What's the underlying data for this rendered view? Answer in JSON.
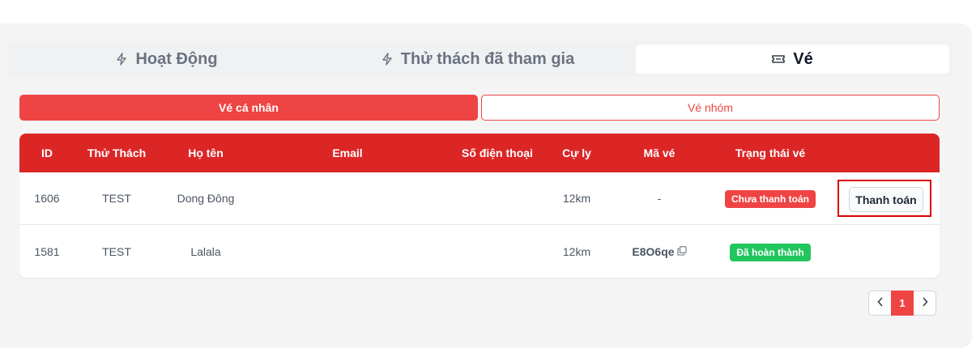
{
  "tabs": [
    {
      "label": "Hoạt Động",
      "icon": "bolt-icon"
    },
    {
      "label": "Thử thách đã tham gia",
      "icon": "bolt-icon"
    },
    {
      "label": "Vé",
      "icon": "ticket-icon",
      "active": true
    }
  ],
  "subtabs": {
    "personal": "Vé cá nhân",
    "group": "Vé nhóm"
  },
  "table": {
    "headers": [
      "ID",
      "Thử Thách",
      "Họ tên",
      "Email",
      "Số điện thoại",
      "Cự ly",
      "Mã vé",
      "Trạng thái vé"
    ],
    "rows": [
      {
        "id": "1606",
        "challenge": "TEST",
        "name": "Dong Đông",
        "email": "",
        "phone": "",
        "distance": "12km",
        "code": "-",
        "status": "Chưa thanh toán",
        "action": "Thanh toán"
      },
      {
        "id": "1581",
        "challenge": "TEST",
        "name": "Lalala",
        "email": "",
        "phone": "",
        "distance": "12km",
        "code": "E8O6qe",
        "status": "Đã hoàn thành"
      }
    ]
  },
  "pagination": {
    "current": "1",
    "prev_icon": "chevron-left-icon",
    "next_icon": "chevron-right-icon"
  },
  "colors": {
    "accent": "#ef4444",
    "header": "#dc2626",
    "success": "#22c55e"
  }
}
